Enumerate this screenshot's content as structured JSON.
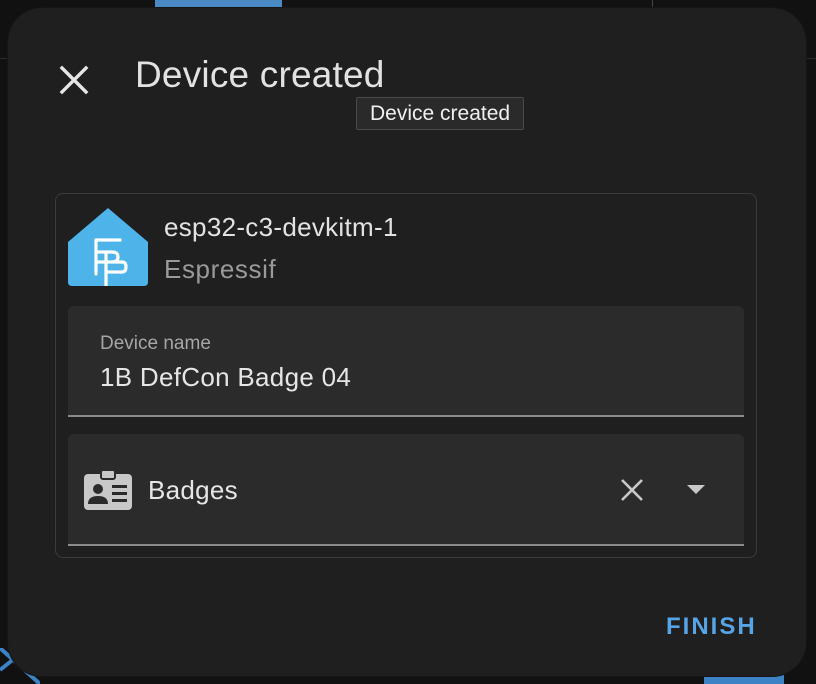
{
  "dialog": {
    "title": "Device created",
    "tooltip": "Device created",
    "close_icon": "close-icon"
  },
  "device": {
    "model": "esp32-c3-devkitm-1",
    "manufacturer": "Espressif",
    "logo_icon": "home-assistant-logo-icon"
  },
  "name_field": {
    "label": "Device name",
    "value": "1B DefCon Badge 04"
  },
  "area_field": {
    "value": "Badges",
    "icon": "badge-account-icon",
    "clear_icon": "close-icon",
    "dropdown_icon": "chevron-down-icon"
  },
  "actions": {
    "finish_label": "FINISH"
  },
  "colors": {
    "accent": "#56a3e6",
    "logo": "#4eb3e8",
    "dialog_bg": "#1f1f1f",
    "field_bg": "#2b2b2b"
  }
}
